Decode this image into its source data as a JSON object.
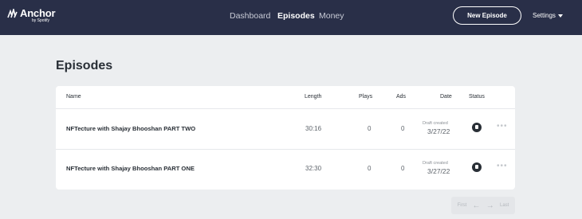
{
  "brand": {
    "name": "Anchor",
    "sub": "by Spotify"
  },
  "nav": {
    "dashboard": "Dashboard",
    "episodes": "Episodes",
    "money": "Money"
  },
  "header": {
    "new_episode": "New Episode",
    "settings": "Settings"
  },
  "page": {
    "title": "Episodes"
  },
  "table": {
    "headers": {
      "name": "Name",
      "length": "Length",
      "plays": "Plays",
      "ads": "Ads",
      "date": "Date",
      "status": "Status"
    },
    "rows": [
      {
        "name": "NFTecture with Shajay Bhooshan PART TWO",
        "length": "30:16",
        "plays": "0",
        "ads": "0",
        "date_label": "Draft created",
        "date": "3/27/22"
      },
      {
        "name": "NFTecture with Shajay Bhooshan PART ONE",
        "length": "32:30",
        "plays": "0",
        "ads": "0",
        "date_label": "Draft created",
        "date": "3/27/22"
      }
    ]
  },
  "pagination": {
    "first": "First",
    "last": "Last"
  },
  "icons": {
    "status": "draft-icon",
    "more": "more-icon",
    "prev": "arrow-left-icon",
    "next": "arrow-right-icon"
  }
}
